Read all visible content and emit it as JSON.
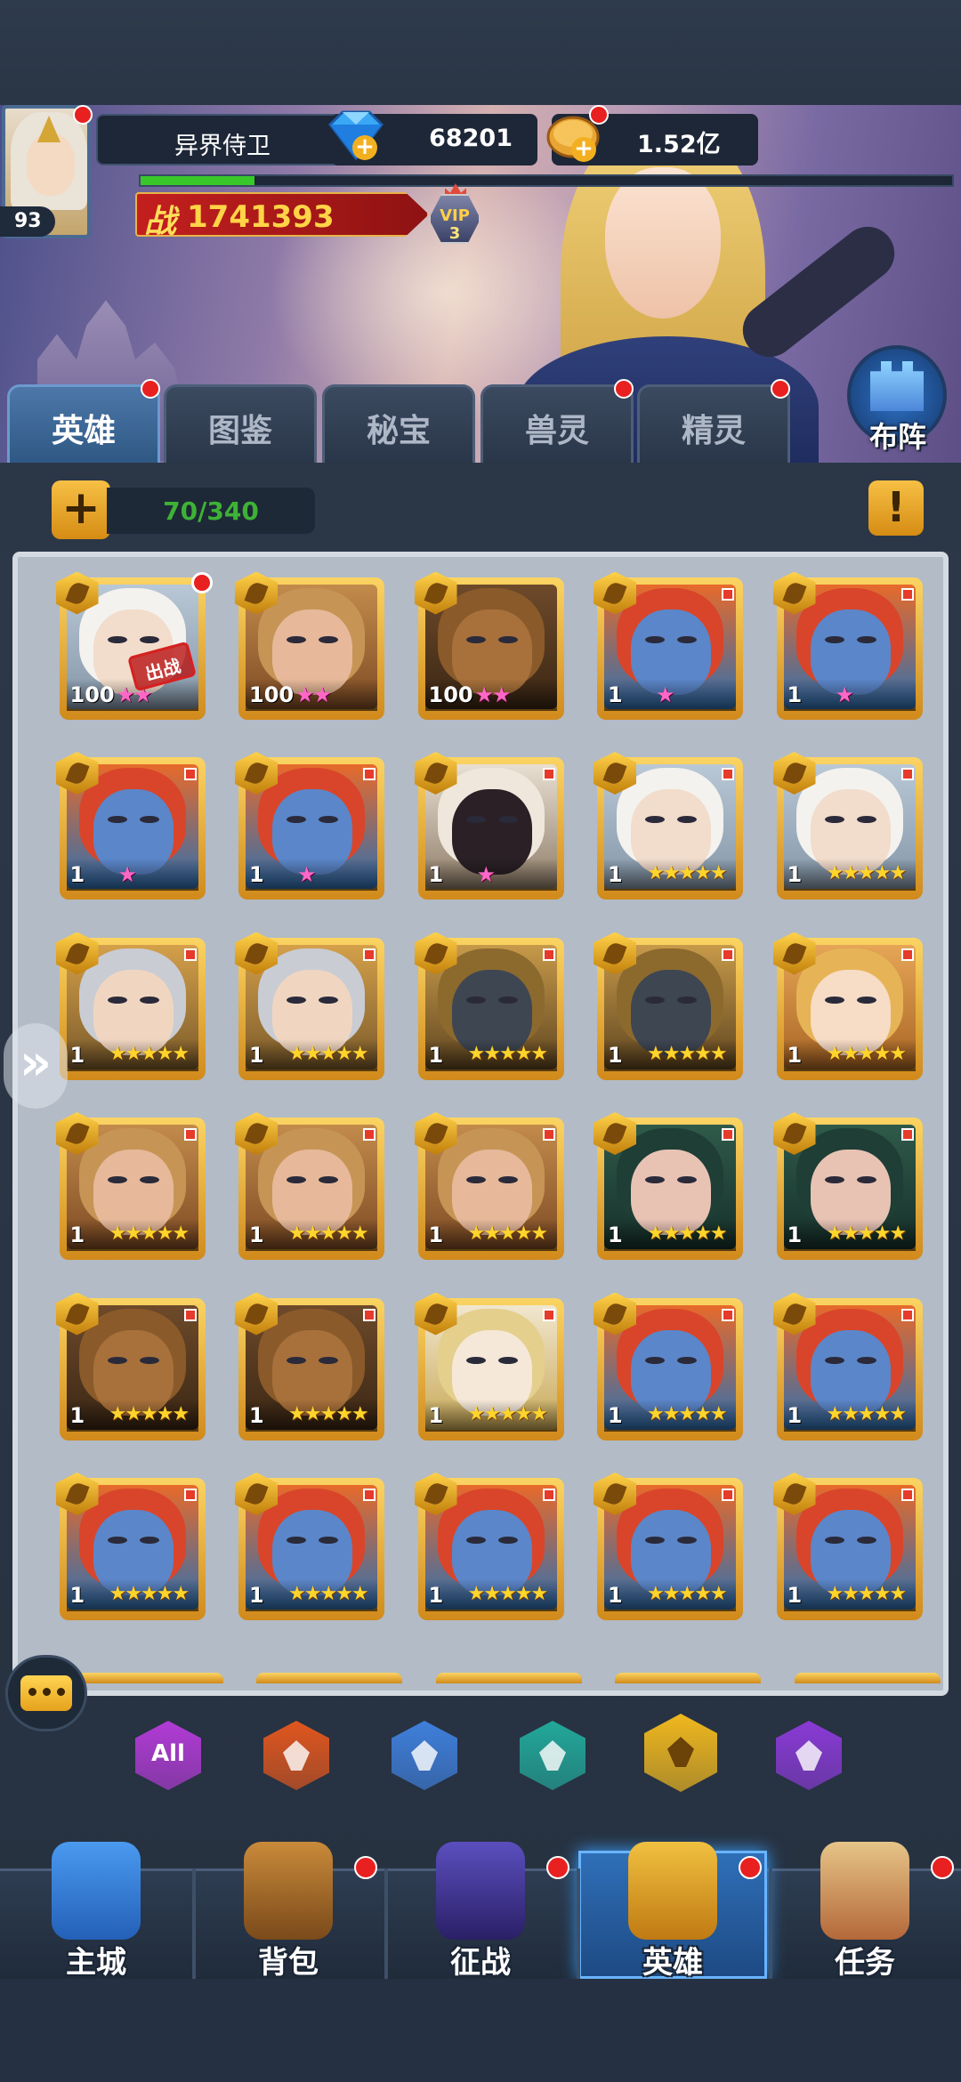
{
  "player": {
    "name": "异界侍卫",
    "level": "93",
    "diamonds": "68201",
    "gold": "1.52亿",
    "power_label": "战",
    "power": "1741393",
    "vip_label": "VIP",
    "vip_level": "3",
    "xp_progress": 0.14
  },
  "tabs": [
    {
      "label": "英雄",
      "active": true,
      "badge": true
    },
    {
      "label": "图鉴",
      "active": false,
      "badge": false
    },
    {
      "label": "秘宝",
      "active": false,
      "badge": false
    },
    {
      "label": "兽灵",
      "active": false,
      "badge": true
    },
    {
      "label": "精灵",
      "active": false,
      "badge": true
    }
  ],
  "formation_label": "布阵",
  "hero_count": "70/340",
  "add_label": "+",
  "info_label": "!",
  "deployed_stamp": "出战",
  "heroes": [
    {
      "portrait": "white-hair",
      "level": "100",
      "stars": 2,
      "star_color": "pink",
      "deployed": true,
      "dot": true
    },
    {
      "portrait": "elf-prince",
      "level": "100",
      "stars": 2,
      "star_color": "pink"
    },
    {
      "portrait": "hooded-bronze",
      "level": "100",
      "stars": 2,
      "star_color": "pink"
    },
    {
      "portrait": "blue-troll",
      "level": "1",
      "stars": 1,
      "star_color": "pink"
    },
    {
      "portrait": "blue-troll",
      "level": "1",
      "stars": 1,
      "star_color": "pink"
    },
    {
      "portrait": "blue-troll",
      "level": "1",
      "stars": 1,
      "star_color": "pink"
    },
    {
      "portrait": "blue-troll",
      "level": "1",
      "stars": 1,
      "star_color": "pink"
    },
    {
      "portrait": "hooded-mage",
      "level": "1",
      "stars": 1,
      "star_color": "pink"
    },
    {
      "portrait": "white-hair",
      "level": "1",
      "stars": 5,
      "star_color": "gold"
    },
    {
      "portrait": "white-hair",
      "level": "1",
      "stars": 5,
      "star_color": "gold"
    },
    {
      "portrait": "silver-knight",
      "level": "1",
      "stars": 5,
      "star_color": "gold"
    },
    {
      "portrait": "silver-knight",
      "level": "1",
      "stars": 5,
      "star_color": "gold"
    },
    {
      "portrait": "dark-golem",
      "level": "1",
      "stars": 5,
      "star_color": "gold"
    },
    {
      "portrait": "dark-golem",
      "level": "1",
      "stars": 5,
      "star_color": "gold"
    },
    {
      "portrait": "blonde-girl",
      "level": "1",
      "stars": 5,
      "star_color": "gold"
    },
    {
      "portrait": "elf-prince",
      "level": "1",
      "stars": 5,
      "star_color": "gold"
    },
    {
      "portrait": "elf-prince",
      "level": "1",
      "stars": 5,
      "star_color": "gold"
    },
    {
      "portrait": "elf-prince",
      "level": "1",
      "stars": 5,
      "star_color": "gold"
    },
    {
      "portrait": "dark-elf",
      "level": "1",
      "stars": 5,
      "star_color": "gold"
    },
    {
      "portrait": "dark-elf",
      "level": "1",
      "stars": 5,
      "star_color": "gold"
    },
    {
      "portrait": "hooded-bronze",
      "level": "1",
      "stars": 5,
      "star_color": "gold"
    },
    {
      "portrait": "hooded-bronze",
      "level": "1",
      "stars": 5,
      "star_color": "gold"
    },
    {
      "portrait": "golden-paladin",
      "level": "1",
      "stars": 5,
      "star_color": "gold"
    },
    {
      "portrait": "blue-troll",
      "level": "1",
      "stars": 5,
      "star_color": "gold"
    },
    {
      "portrait": "blue-troll",
      "level": "1",
      "stars": 5,
      "star_color": "gold"
    },
    {
      "portrait": "blue-troll",
      "level": "1",
      "stars": 5,
      "star_color": "gold"
    },
    {
      "portrait": "blue-troll",
      "level": "1",
      "stars": 5,
      "star_color": "gold"
    },
    {
      "portrait": "blue-troll",
      "level": "1",
      "stars": 5,
      "star_color": "gold"
    },
    {
      "portrait": "blue-troll",
      "level": "1",
      "stars": 5,
      "star_color": "gold"
    },
    {
      "portrait": "blue-troll",
      "level": "1",
      "stars": 5,
      "star_color": "gold"
    }
  ],
  "filters": [
    {
      "label": "All",
      "icon": "all-icon",
      "color": "#b23bd6",
      "selected": false
    },
    {
      "label": "",
      "icon": "fire-faction-icon",
      "color": "#e0561e",
      "selected": false
    },
    {
      "label": "",
      "icon": "cross-faction-icon",
      "color": "#3f7fdc",
      "selected": false
    },
    {
      "label": "",
      "icon": "skull-faction-icon",
      "color": "#22a89a",
      "selected": false
    },
    {
      "label": "",
      "icon": "leaf-faction-icon",
      "color": "#f0b81e",
      "selected": true
    },
    {
      "label": "",
      "icon": "dark-faction-icon",
      "color": "#8a3ad6",
      "selected": false
    }
  ],
  "nav": [
    {
      "label": "主城",
      "icon": "castle-icon",
      "badge": false,
      "active": false
    },
    {
      "label": "背包",
      "icon": "chest-icon",
      "badge": true,
      "active": false
    },
    {
      "label": "征战",
      "icon": "dragon-portal-icon",
      "badge": true,
      "active": false
    },
    {
      "label": "英雄",
      "icon": "hero-helmet-icon",
      "badge": true,
      "active": true
    },
    {
      "label": "任务",
      "icon": "scroll-icon",
      "badge": true,
      "active": false
    }
  ],
  "colors": {
    "accent_gold": "#f0b81e",
    "badge_red": "#e82020",
    "xp_green": "#39c82a"
  }
}
